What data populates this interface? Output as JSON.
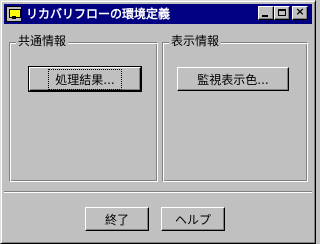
{
  "window": {
    "title": "リカバリフローの環境定義",
    "icon": "app-icon",
    "controls": {
      "minimize": "minimize-icon",
      "maximize": "maximize-icon",
      "close": "×"
    }
  },
  "groups": {
    "common": {
      "label": "共通情報",
      "button_label": "処理結果..."
    },
    "display": {
      "label": "表示情報",
      "button_label": "監視表示色..."
    }
  },
  "footer": {
    "exit_label": "終了",
    "help_label": "ヘルプ"
  },
  "colors": {
    "face": "#c0c0c0",
    "titlebar": "#000080",
    "title_text": "#ffffff"
  }
}
